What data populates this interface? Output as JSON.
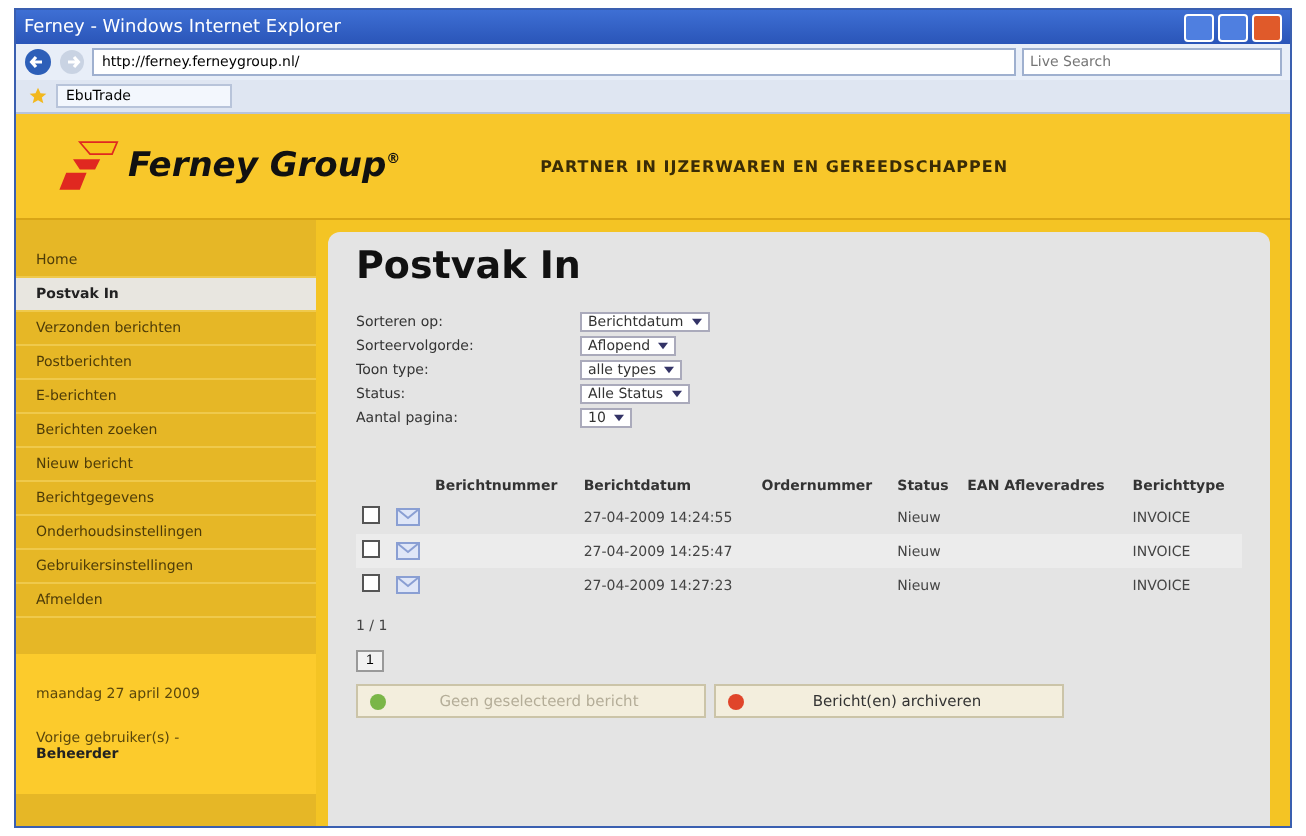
{
  "window": {
    "title": "Ferney - Windows Internet Explorer"
  },
  "browser": {
    "address": "http://ferney.ferneygroup.nl/",
    "search_placeholder": "Live Search",
    "tab": "EbuTrade"
  },
  "header": {
    "logo": "Ferney Group",
    "logo_mark": "®",
    "tagline": "PARTNER IN IJZERWAREN EN GEREEDSCHAPPEN"
  },
  "sidebar": {
    "items": [
      {
        "label": "Home",
        "selected": false
      },
      {
        "label": "Postvak In",
        "selected": true
      },
      {
        "label": "Verzonden berichten",
        "selected": false
      },
      {
        "label": "Postberichten",
        "selected": false
      },
      {
        "label": "E-berichten",
        "selected": false
      },
      {
        "label": "Berichten zoeken",
        "selected": false
      },
      {
        "label": "Nieuw bericht",
        "selected": false
      },
      {
        "label": "Berichtgegevens",
        "selected": false
      },
      {
        "label": "Onderhoudsinstellingen",
        "selected": false
      },
      {
        "label": "Gebruikersinstellingen",
        "selected": false
      },
      {
        "label": "Afmelden",
        "selected": false
      }
    ],
    "date": "maandag 27 april 2009",
    "user_label": "Vorige gebruiker(s) -",
    "user": "Beheerder"
  },
  "page": {
    "title": "Postvak In",
    "filters": [
      {
        "label": "Sorteren op:",
        "value": "Berichtdatum"
      },
      {
        "label": "Sorteervolgorde:",
        "value": "Aflopend"
      },
      {
        "label": "Toon type:",
        "value": "alle types"
      },
      {
        "label": "Status:",
        "value": "Alle Status"
      },
      {
        "label": "Aantal pagina:",
        "value": "10"
      }
    ],
    "table": {
      "columns": [
        "Berichtnummer",
        "Berichtdatum",
        "Ordernummer",
        "Status",
        "EAN Afleveradres",
        "Berichttype"
      ],
      "rows": [
        {
          "checked": false,
          "cells": [
            "",
            "27-04-2009 14:24:55",
            "",
            "Nieuw",
            "",
            "INVOICE"
          ]
        },
        {
          "checked": false,
          "cells": [
            "",
            "27-04-2009 14:25:47",
            "",
            "Nieuw",
            "",
            "INVOICE"
          ]
        },
        {
          "checked": false,
          "cells": [
            "",
            "27-04-2009 14:27:23",
            "",
            "Nieuw",
            "",
            "INVOICE"
          ]
        }
      ]
    },
    "pager": "1 / 1",
    "page_button": "1",
    "buttons": [
      {
        "label": "Geen geselecteerd bericht",
        "disabled": true,
        "kind": "ok"
      },
      {
        "label": "Bericht(en) archiveren",
        "disabled": false,
        "kind": "archive"
      }
    ]
  }
}
